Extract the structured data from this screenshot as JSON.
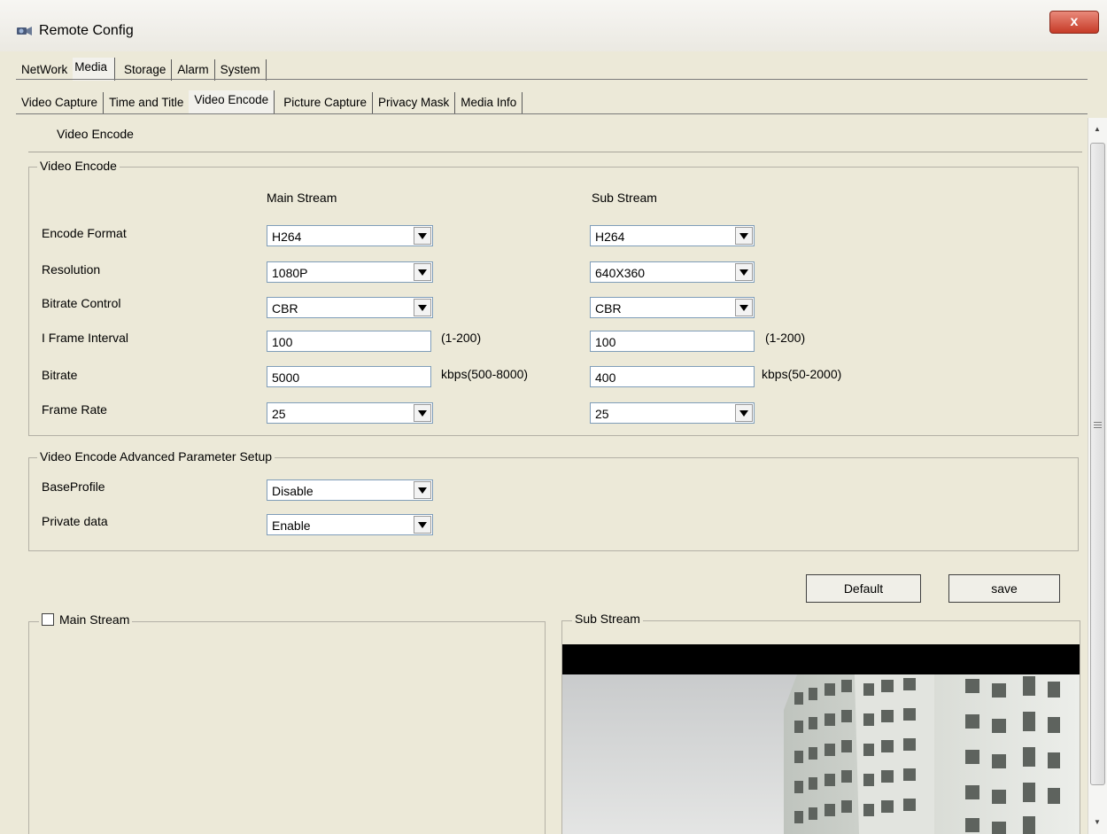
{
  "window": {
    "title": "Remote Config",
    "close_symbol": "x"
  },
  "tabs_top": [
    "NetWork",
    "Media",
    "Storage",
    "Alarm",
    "System"
  ],
  "tabs_sub": [
    "Video Capture",
    "Time and Title",
    "Video Encode",
    "Picture Capture",
    "Privacy Mask",
    "Media Info"
  ],
  "section_title": "Video Encode",
  "video_encode": {
    "group_title": "Video Encode",
    "main_header": "Main Stream",
    "sub_header": "Sub Stream",
    "rows": [
      {
        "label": "Encode Format",
        "main": "H264",
        "sub": "H264"
      },
      {
        "label": "Resolution",
        "main": "1080P",
        "sub": "640X360"
      },
      {
        "label": "Bitrate Control",
        "main": "CBR",
        "sub": "CBR"
      },
      {
        "label": "I Frame Interval",
        "main": "100",
        "main_hint": "(1-200)",
        "sub": "100",
        "sub_hint": "(1-200)"
      },
      {
        "label": "Bitrate",
        "main": "5000",
        "main_hint": "kbps(500-8000)",
        "sub": "400",
        "sub_hint": "kbps(50-2000)"
      },
      {
        "label": "Frame Rate",
        "main": "25",
        "sub": "25"
      }
    ]
  },
  "advanced": {
    "group_title": "Video Encode Advanced Parameter Setup",
    "rows": [
      {
        "label": "BaseProfile",
        "value": "Disable"
      },
      {
        "label": "Private data",
        "value": "Enable"
      }
    ]
  },
  "buttons": {
    "default": "Default",
    "save": "save"
  },
  "preview": {
    "main_label": "Main Stream",
    "main_checked": false,
    "sub_label": "Sub Stream"
  },
  "colors": {
    "window_bg": "#ece9d8",
    "close_button": "#c63b27",
    "field_border": "#7f9db9"
  }
}
